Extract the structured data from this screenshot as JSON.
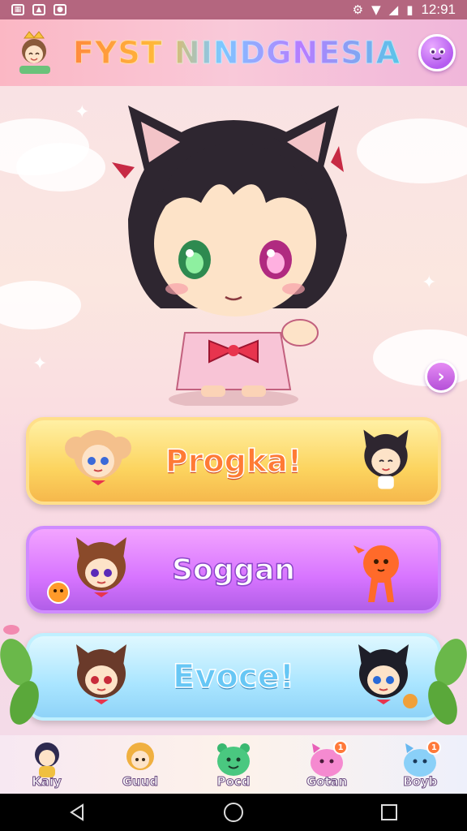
{
  "status_bar": {
    "time": "12:91",
    "left_icons": [
      "sim-icon",
      "image-icon",
      "notification-icon"
    ],
    "right_icons": [
      "settings-icon",
      "wifi-icon",
      "signal-icon",
      "battery-icon"
    ]
  },
  "header": {
    "title": "FYST NINDGNESIA",
    "avatar_icon": "avatar-icon",
    "menu_icon": "slime-menu-icon"
  },
  "scene": {
    "next_icon": "chevron-right-icon"
  },
  "modes": [
    {
      "label": "Progka!",
      "color": "#fcd45f"
    },
    {
      "label": "Soggan",
      "color": "#d774ff"
    },
    {
      "label": "Evoce!",
      "color": "#a9e5ff"
    }
  ],
  "bottom_nav": {
    "items": [
      {
        "label": "Kaiy",
        "icon": "character-icon"
      },
      {
        "label": "Guud",
        "icon": "guild-icon"
      },
      {
        "label": "Pocd",
        "icon": "pet-icon"
      },
      {
        "label": "Gotan",
        "icon": "gacha-icon",
        "badge": "1"
      },
      {
        "label": "Boyb",
        "icon": "box-icon",
        "badge": "1"
      }
    ]
  },
  "system_nav": {
    "back_icon": "back-icon",
    "home_icon": "home-icon",
    "recents_icon": "recents-icon"
  }
}
